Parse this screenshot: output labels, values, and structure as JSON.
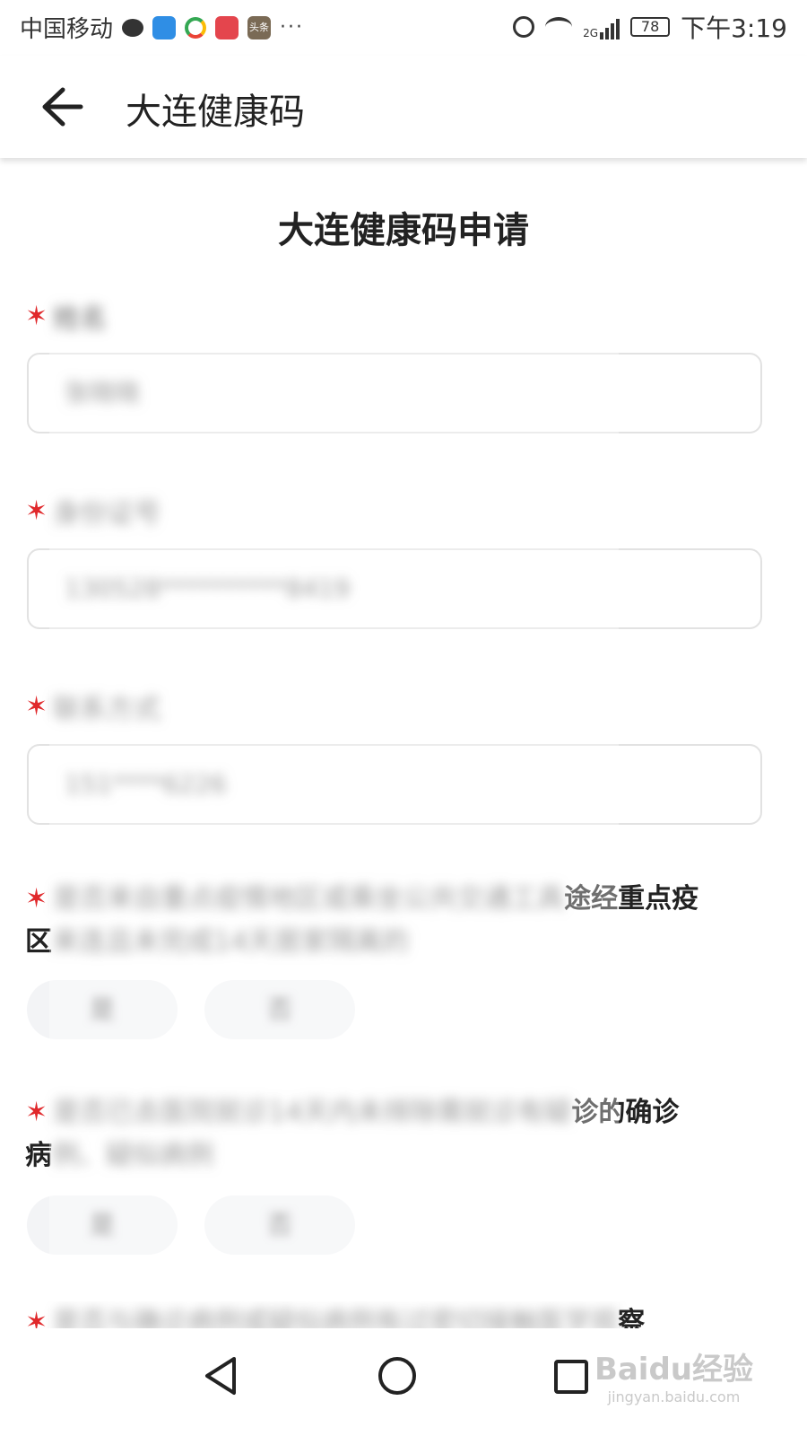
{
  "status_bar": {
    "carrier": "中国移动",
    "dots": "···",
    "network": "2G",
    "battery": "78",
    "time": "下午3:19",
    "news_icon_text": "头条"
  },
  "app_bar": {
    "title": "大连健康码"
  },
  "page_title": "大连健康码申请",
  "fields": [
    {
      "label": "姓名",
      "value": "张晓晓"
    },
    {
      "label": "身份证号",
      "value": "130528**********8419"
    },
    {
      "label": "联系方式",
      "value": "151****6226"
    }
  ],
  "questions": [
    {
      "text_blur": "是否来自重点疫情地区或乘坐公共交通工具",
      "text_clear": "途经重点疫",
      "text_line2_first": "区",
      "text_line2_blur": "来连且未完成14天居家隔离的",
      "options": [
        "是",
        "否"
      ]
    },
    {
      "text_blur": "是否已去医院就诊14天内未排除需就诊有疑",
      "text_clear": "诊的确诊",
      "text_line2_first": "病",
      "text_line2_blur": "例、疑似病例",
      "options": [
        "是",
        "否"
      ]
    },
    {
      "text_blur": "是否与确诊病例或疑似病例有过密切接触医学观",
      "text_clear": "察"
    }
  ],
  "watermark": {
    "brand": "Baidu经验",
    "url": "jingyan.baidu.com"
  }
}
